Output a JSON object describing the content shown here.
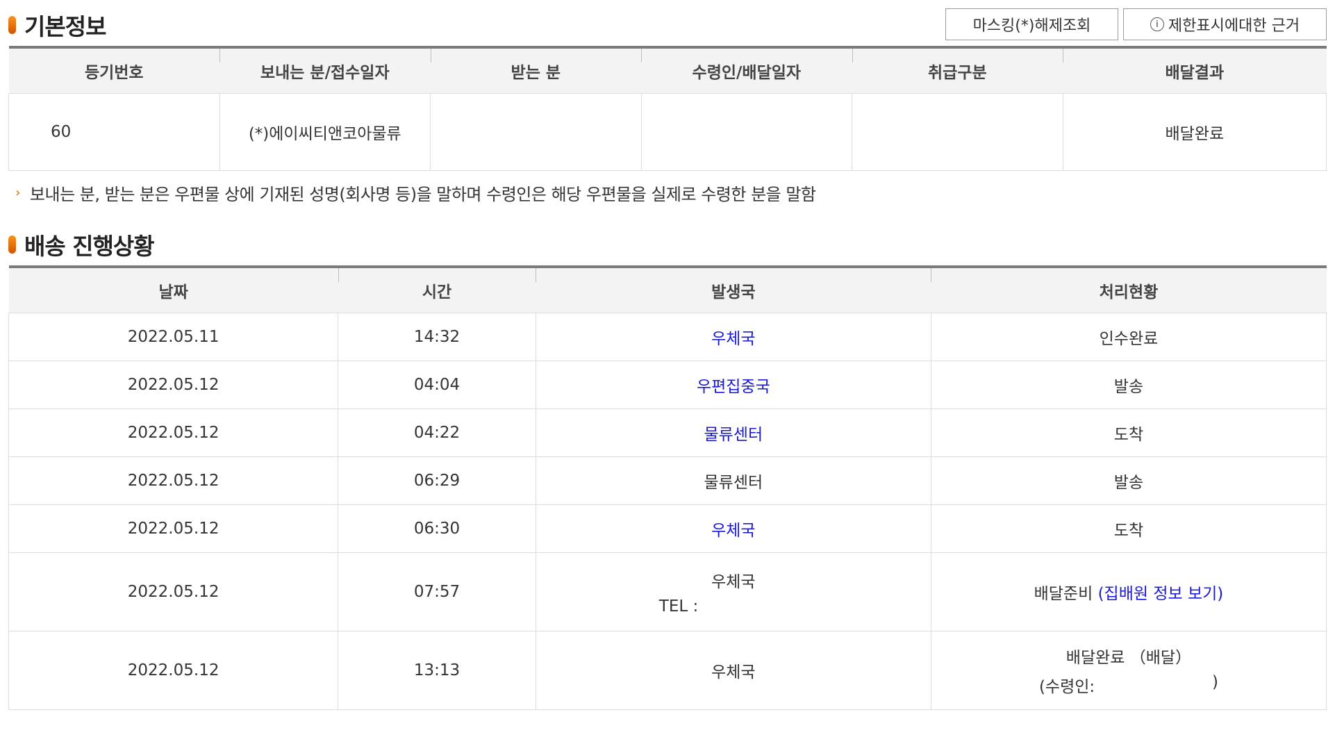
{
  "basic_info": {
    "title": "기본정보",
    "buttons": {
      "mask_release": "마스킹(*)해제조회",
      "info_icon": "i",
      "restriction_basis": "제한표시에대한 근거"
    },
    "headers": [
      "등기번호",
      "보내는 분/접수일자",
      "받는 분",
      "수령인/배달일자",
      "취급구분",
      "배달결과"
    ],
    "row": {
      "reg_number": "60",
      "sender": "(*)에이씨티앤코아물류",
      "receiver": "",
      "recipient_date": "",
      "handling": "",
      "result": "배달완료"
    },
    "note": "보내는 분, 받는 분은 우편물 상에 기재된 성명(회사명 등)을 말하며 수령인은 해당 우편물을 실제로 수령한 분을 말함"
  },
  "delivery_progress": {
    "title": "배송 진행상황",
    "headers": [
      "날짜",
      "시간",
      "발생국",
      "처리현황"
    ],
    "rows": [
      {
        "date": "2022.05.11",
        "time": "14:32",
        "office": "우체국",
        "status": "인수완료"
      },
      {
        "date": "2022.05.12",
        "time": "04:04",
        "office": "우편집중국",
        "status": "발송"
      },
      {
        "date": "2022.05.12",
        "time": "04:22",
        "office": "물류센터",
        "status": "도착"
      },
      {
        "date": "2022.05.12",
        "time": "06:29",
        "office": "물류센터",
        "status": "발송"
      },
      {
        "date": "2022.05.12",
        "time": "06:30",
        "office": "우체국",
        "status": "도착"
      },
      {
        "date": "2022.05.12",
        "time": "07:57",
        "office": "우체국",
        "office_tel": "TEL :",
        "status": "배달준비",
        "status_link": "(집배원 정보 보기)"
      },
      {
        "date": "2022.05.12",
        "time": "13:13",
        "office": "우체국",
        "status": "배달완료 （배달）",
        "receiver_label": "(수령인:",
        "receiver_close": ")"
      }
    ]
  },
  "colors": {
    "accent_bullet": "#e8731a",
    "link_blue": "#1a1ad6",
    "header_bg": "#f3f3f3",
    "header_top_border": "#7a7a7a"
  }
}
